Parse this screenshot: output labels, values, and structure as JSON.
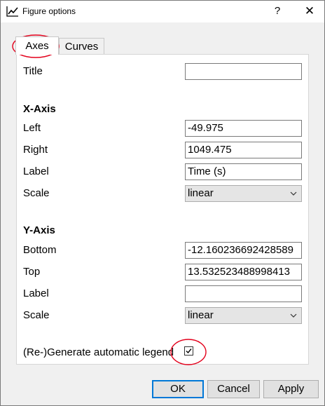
{
  "window": {
    "title": "Figure options",
    "help_symbol": "?",
    "close_symbol": "✕"
  },
  "tabs": [
    {
      "label": "Axes",
      "active": true
    },
    {
      "label": "Curves",
      "active": false
    }
  ],
  "form": {
    "title_label": "Title",
    "title_value": "",
    "x_axis": {
      "heading": "X-Axis",
      "left_label": "Left",
      "left_value": "-49.975",
      "right_label": "Right",
      "right_value": "1049.475",
      "label_label": "Label",
      "label_value": "Time (s)",
      "scale_label": "Scale",
      "scale_value": "linear"
    },
    "y_axis": {
      "heading": "Y-Axis",
      "bottom_label": "Bottom",
      "bottom_value": "-12.160236692428589",
      "top_label": "Top",
      "top_value": "13.532523488998413",
      "label_label": "Label",
      "label_value": "",
      "scale_label": "Scale",
      "scale_value": "linear"
    },
    "legend_label": "(Re-)Generate automatic legend",
    "legend_checked": true
  },
  "buttons": {
    "ok": "OK",
    "cancel": "Cancel",
    "apply": "Apply"
  },
  "colors": {
    "focus_border": "#0078d7",
    "annotation": "#e3001b"
  }
}
